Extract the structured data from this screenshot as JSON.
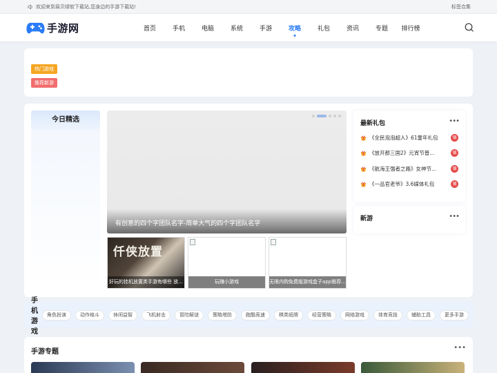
{
  "topbar": {
    "notice": "欢迎来到易贝绿软下载站,您身边的手游下载站!",
    "right_link": "标签合集"
  },
  "header": {
    "logo_text": "手游网",
    "nav": [
      "首页",
      "手机",
      "电脑",
      "系统",
      "手游",
      "攻略",
      "礼包",
      "资讯",
      "专题",
      "排行榜"
    ],
    "active_nav": "攻略"
  },
  "tags": {
    "hot": "热门游戏",
    "recommend": "推荐新游"
  },
  "today": {
    "title": "今日精选"
  },
  "slider": {
    "caption": "有创意的四个字团队名字-简单大气的四个字团队名字",
    "dot_count": 5,
    "active_dot": 1
  },
  "thumbs": [
    {
      "art_text": "仟侠放置",
      "caption": "好玩的挂机放置类手游有哪些 放..."
    },
    {
      "caption": "玩赚小游戏"
    },
    {
      "caption": "无限内购免费版游戏盒子app推荐..."
    }
  ],
  "gifts": {
    "title": "最新礼包",
    "badge": "領",
    "items": [
      "《全民泡泡超人》61童年礼包",
      "《放开那三国2》元宵节普...",
      "《航海王强者之路》女神节...",
      "《一品官老爷》3.6媒体礼包"
    ]
  },
  "newgame": {
    "title": "新游"
  },
  "categories": {
    "title": "手机游戏",
    "items": [
      "角色扮演",
      "动作格斗",
      "休闲益智",
      "飞机射击",
      "冒险解谜",
      "策略塔防",
      "跑酷竞速",
      "棋类纸牌",
      "经营策略",
      "网络游戏",
      "体育竞技",
      "辅助工具",
      "更多手游"
    ]
  },
  "topics": {
    "title": "手游专题"
  },
  "colors": {
    "accent": "#2a7cf6",
    "hot": "#f5a623",
    "recommend": "#f26d6d",
    "badge": "#e64a4a"
  }
}
